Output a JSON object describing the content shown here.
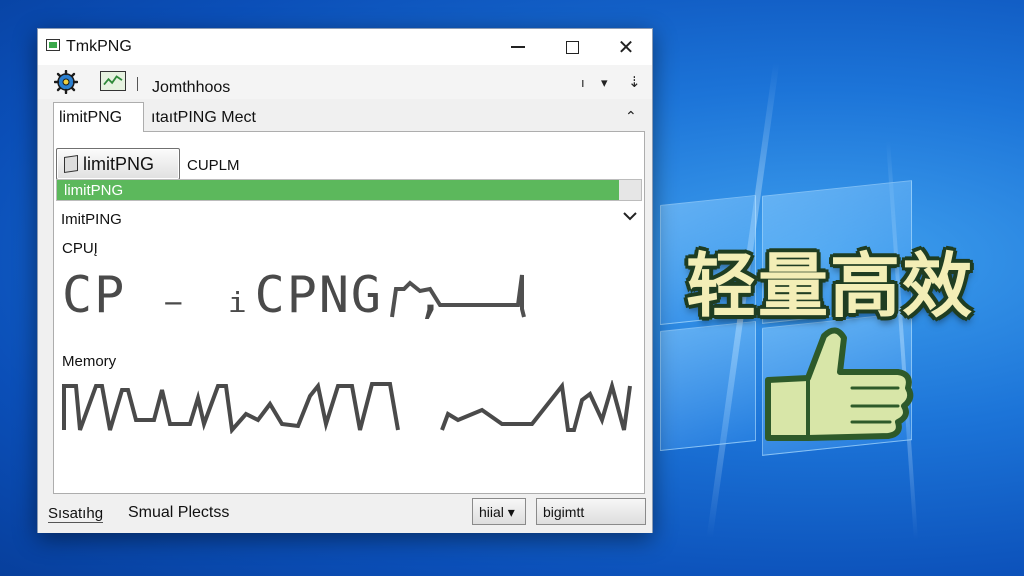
{
  "window": {
    "title": "TmkPNG",
    "close_glyph": "✕"
  },
  "toolbar": {
    "label": "Jomthhoos",
    "right1": "ı",
    "right2": "▾",
    "right3": "⇣"
  },
  "tabs": [
    {
      "label": "limitPNG"
    },
    {
      "label": "ıtaıtPING Mect"
    }
  ],
  "tabs_chevron": "⌃",
  "panel": {
    "limit_button_label": "limitPNG",
    "cpulm_label": "CUPLM",
    "progress": {
      "label": "limitPNG",
      "fraction": 0.963
    },
    "dropdown_label": "ImitPING",
    "cpu_title": "CPUĮ",
    "cpu_graph_text": "CP ₋ ᵢCPNG ,",
    "memory_title": "Memory"
  },
  "statusbar": {
    "left": "Sısatıhg",
    "middle": "Smual Plectss",
    "button1": "hiial ▾",
    "button2": "bigimtt"
  },
  "overlay": {
    "promo_text": "轻量高效"
  },
  "colors": {
    "progress_fill": "#5cb85c",
    "promo_text": "#f3eeb6",
    "promo_outline": "#1f3d22",
    "thumb_fill": "#d8e6a8",
    "desktop_blue": "#1c74d8"
  },
  "icons": [
    "app-icon",
    "gear-icon",
    "chart-icon",
    "chevron-down-icon",
    "chevron-up-icon",
    "thumbs-up-icon",
    "windows-logo-icon"
  ]
}
